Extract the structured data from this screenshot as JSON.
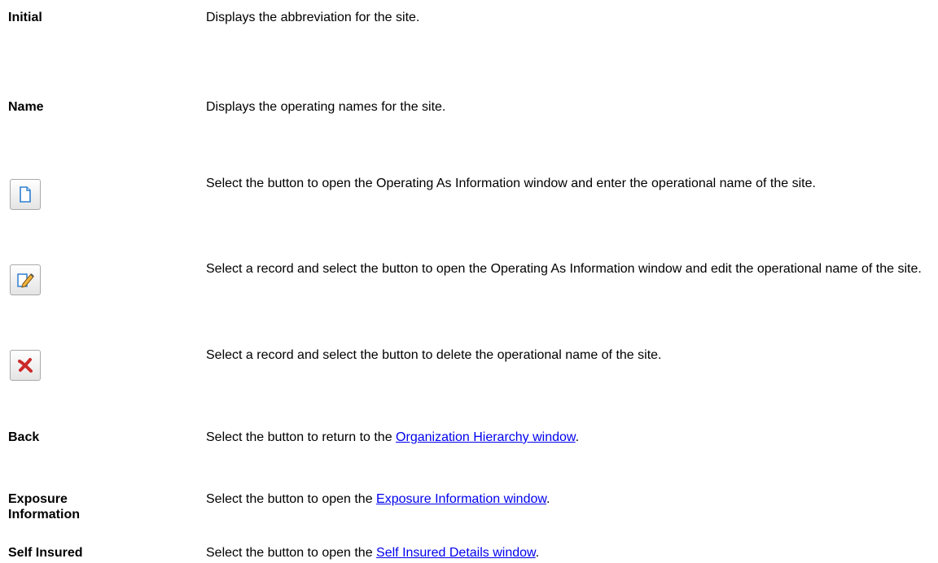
{
  "rows": {
    "initial": {
      "term": "Initial",
      "desc": "Displays the abbreviation for the site."
    },
    "name": {
      "term": "Name",
      "desc": "Displays the operating names for the site."
    },
    "new": {
      "icon": "new-document-icon",
      "desc": "Select the button to open the Operating As Information window and enter the operational name of the site."
    },
    "edit": {
      "icon": "edit-pencil-icon",
      "desc": "Select a record and select the button to open the Operating As Information window and edit the operational name of the site."
    },
    "delete": {
      "icon": "delete-x-icon",
      "desc": "Select a record and select the button to delete the operational name of the site."
    },
    "back": {
      "term": "Back",
      "desc_before": "Select the button to return to the ",
      "link": "Organization Hierarchy window",
      "desc_after": "."
    },
    "exposure": {
      "term_line1": "Exposure",
      "term_line2": "Information",
      "desc_before": "Select the button to open the ",
      "link": "Exposure Information window",
      "desc_after": "."
    },
    "self_insured": {
      "term": "Self Insured",
      "desc_before": "Select the button to open the ",
      "link": "Self Insured Details window",
      "desc_after": "."
    }
  },
  "colors": {
    "link": "#0000ee",
    "delete_icon": "#cc2a2a",
    "page_icon": "#2e7fd0"
  }
}
